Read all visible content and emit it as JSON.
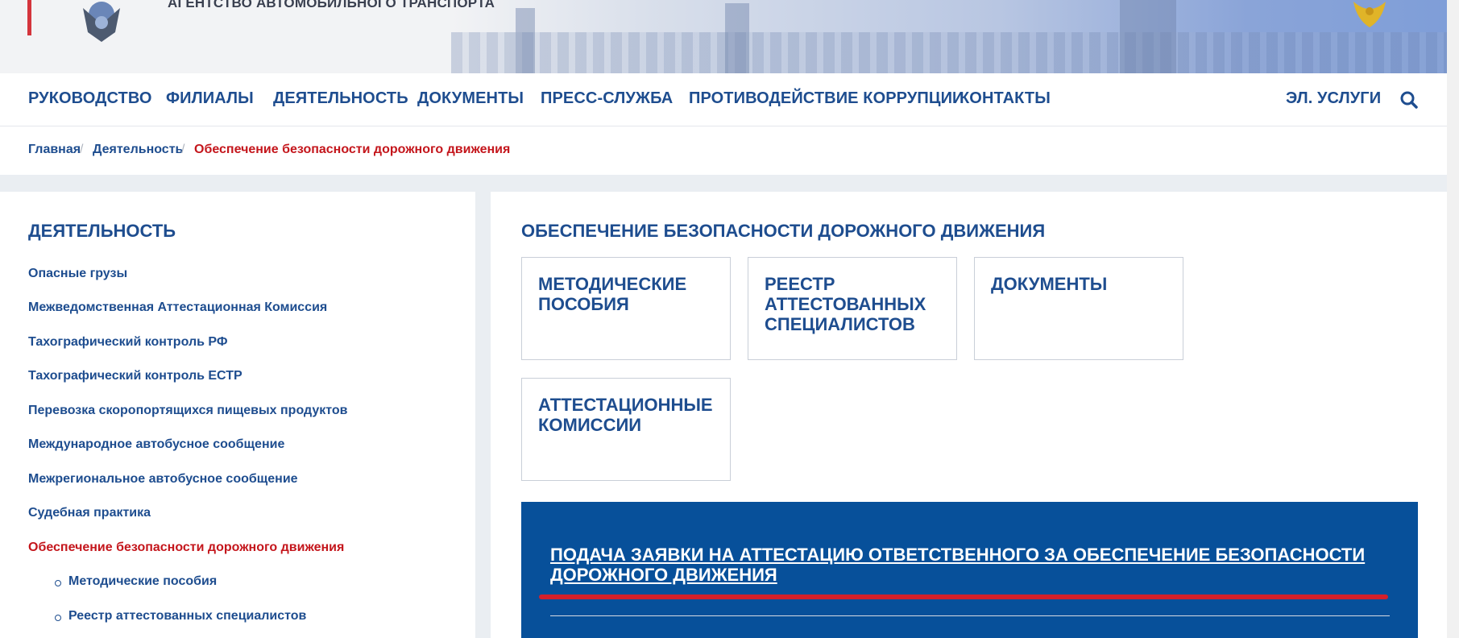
{
  "header": {
    "agency_name": "АГЕНТСТВО АВТОМОБИЛЬНОГО ТРАНСПОРТА"
  },
  "nav": {
    "items": [
      "РУКОВОДСТВО",
      "ФИЛИАЛЫ",
      "ДЕЯТЕЛЬНОСТЬ",
      "ДОКУМЕНТЫ",
      "ПРЕСС-СЛУЖБА",
      "ПРОТИВОДЕЙСТВИЕ КОРРУПЦИИ",
      "КОНТАКТЫ"
    ],
    "services": "ЭЛ. УСЛУГИ"
  },
  "breadcrumbs": {
    "items": [
      "Главная",
      "Деятельность",
      "Обеспечение безопасности дорожного движения"
    ],
    "separator": "/"
  },
  "sidebar": {
    "title": "ДЕЯТЕЛЬНОСТЬ",
    "links": [
      "Опасные грузы",
      "Межведомственная Аттестационная Комиссия",
      "Тахографический контроль РФ",
      "Тахографический контроль ЕСТР",
      "Перевозка скоропортящихся пищевых продуктов",
      "Международное автобусное сообщение",
      "Межрегиональное автобусное сообщение",
      "Судебная практика",
      "Обеспечение безопасности дорожного движения"
    ],
    "sublinks": [
      "Методические пособия",
      "Реестр аттестованных специалистов"
    ]
  },
  "main": {
    "title": "ОБЕСПЕЧЕНИЕ БЕЗОПАСНОСТИ ДОРОЖНОГО ДВИЖЕНИЯ",
    "cards": [
      [
        "МЕТОДИЧЕСКИЕ",
        "ПОСОБИЯ"
      ],
      [
        "РЕЕСТР",
        "АТТЕСТОВАННЫХ",
        "СПЕЦИАЛИСТОВ"
      ],
      [
        "ДОКУМЕНТЫ"
      ],
      [
        "АТТЕСТАЦИОННЫЕ",
        "КОМИССИИ"
      ]
    ],
    "banner_link": "ПОДАЧА ЗАЯВКИ НА АТТЕСТАЦИЮ ОТВЕТСТВЕННОГО ЗА ОБЕСПЕЧЕНИЕ БЕЗОПАСНОСТИ ДОРОЖНОГО ДВИЖЕНИЯ"
  },
  "colors": {
    "primary": "#1e4d8f",
    "active": "#c4161c",
    "banner_bg": "#07509a",
    "accent_red": "#d4202a"
  },
  "icons": [
    "emblem-icon",
    "coat-of-arms-icon",
    "search-icon"
  ]
}
